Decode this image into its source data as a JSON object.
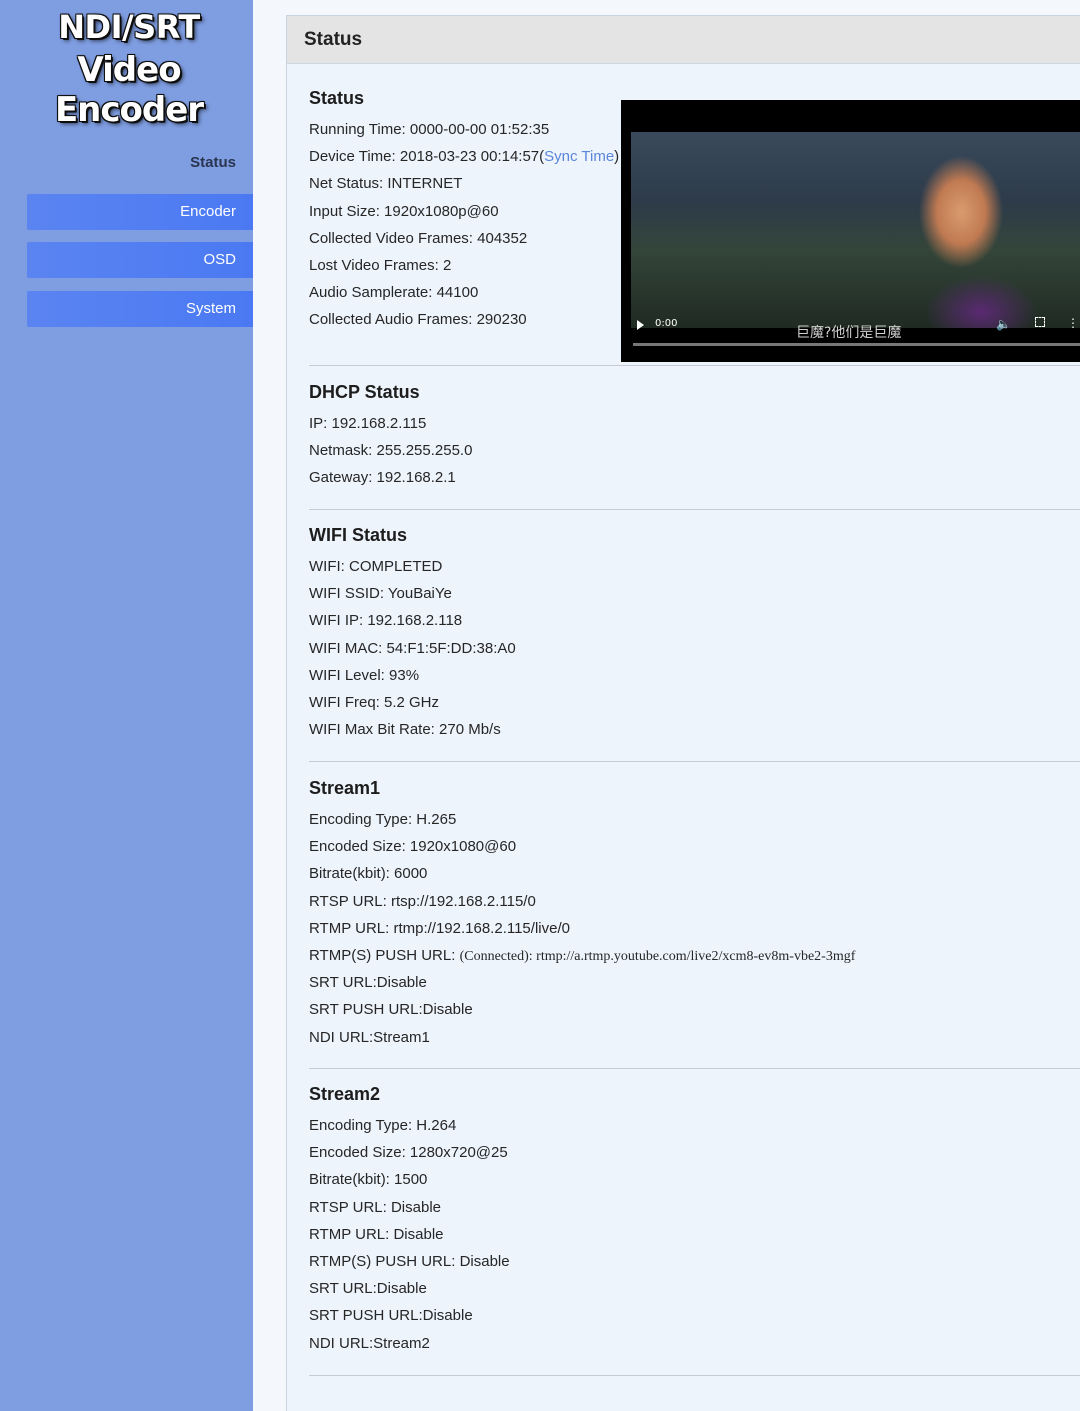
{
  "logo": {
    "line1": "NDI/SRT",
    "line2": "Video Encoder"
  },
  "sidebar": {
    "status_label": "Status",
    "items": [
      {
        "label": "Encoder"
      },
      {
        "label": "OSD"
      },
      {
        "label": "System"
      }
    ]
  },
  "panel": {
    "title": "Status"
  },
  "status": {
    "heading": "Status",
    "running_time": "Running Time: 0000-00-00 01:52:35",
    "device_time": "Device Time: 2018-03-23 00:14:57(",
    "sync_link": "Sync Time",
    "device_time_close": ")",
    "net_status": "Net Status: INTERNET",
    "input_size": "Input Size: 1920x1080p@60",
    "collected_video": "Collected Video Frames: 404352",
    "lost_video": "Lost Video Frames: 2",
    "audio_samplerate": "Audio Samplerate: 44100",
    "collected_audio": "Collected Audio Frames: 290230"
  },
  "video": {
    "time": "0:00",
    "subtitle": "巨魔?他们是巨魔",
    "progress": 0.0
  },
  "dhcp": {
    "heading": "DHCP Status",
    "lines": [
      "IP: 192.168.2.115",
      "Netmask: 255.255.255.0",
      "Gateway: 192.168.2.1"
    ]
  },
  "wifi": {
    "heading": "WIFI Status",
    "lines": [
      "WIFI: COMPLETED",
      "WIFI SSID: YouBaiYe",
      "WIFI IP: 192.168.2.118",
      "WIFI MAC: 54:F1:5F:DD:38:A0",
      "WIFI Level: 93%",
      "WIFI Freq: 5.2 GHz",
      "WIFI Max Bit Rate: 270 Mb/s"
    ]
  },
  "stream1": {
    "heading": "Stream1",
    "encoding": "Encoding Type: H.265",
    "encoded_size": "Encoded Size: 1920x1080@60",
    "bitrate": "Bitrate(kbit): 6000",
    "rtsp": "RTSP URL: rtsp://192.168.2.115/0",
    "rtmp": "RTMP URL: rtmp://192.168.2.115/live/0",
    "push_label": "RTMP(S) PUSH URL: ",
    "push_value": "(Connected): rtmp://a.rtmp.youtube.com/live2/xcm8-ev8m-vbe2-3mgf",
    "srt": "SRT URL:Disable",
    "srt_push": "SRT PUSH URL:Disable",
    "ndi": "NDI URL:Stream1"
  },
  "stream2": {
    "heading": "Stream2",
    "lines": [
      "Encoding Type: H.264",
      "Encoded Size: 1280x720@25",
      "Bitrate(kbit): 1500",
      "RTSP URL: Disable",
      "RTMP URL: Disable",
      "RTMP(S) PUSH URL: Disable",
      "SRT URL:Disable",
      "SRT PUSH URL:Disable",
      "NDI URL:Stream2"
    ]
  }
}
